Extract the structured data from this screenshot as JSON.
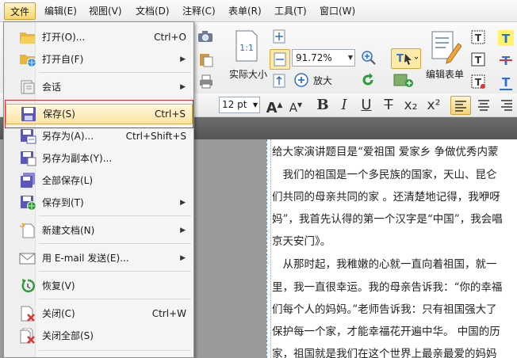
{
  "menubar": {
    "items": [
      "文件",
      "编辑(E)",
      "视图(V)",
      "文档(D)",
      "注释(C)",
      "表单(R)",
      "工具(T)",
      "窗口(W)"
    ]
  },
  "ribbon": {
    "zoom_value": "91.72%",
    "actual_size_label": "实际大小",
    "zoom_in_label": "放大",
    "zoom_out_label": "缩小",
    "edit_form_label": "编辑表单",
    "fit_icon_text": "1:1"
  },
  "format": {
    "font_size": "12 pt",
    "bold": "B",
    "italic": "I",
    "underline": "U",
    "strike": "T",
    "subscript": "x₂",
    "superscript": "x²"
  },
  "file_menu": {
    "items": [
      {
        "label": "打开(O)...",
        "shortcut": "Ctrl+O",
        "icon": "folder-open-icon"
      },
      {
        "label": "打开自(F)",
        "shortcut": "",
        "submenu": true,
        "icon": "folder-globe-icon"
      },
      {
        "label": "会话",
        "shortcut": "",
        "submenu": true,
        "icon": "session-icon"
      },
      {
        "label": "保存(S)",
        "shortcut": "Ctrl+S",
        "icon": "save-icon"
      },
      {
        "label": "另存为(A)...",
        "shortcut": "Ctrl+Shift+S",
        "icon": "save-as-icon"
      },
      {
        "label": "另存为副本(Y)...",
        "shortcut": "",
        "icon": "save-copy-icon"
      },
      {
        "label": "全部保存(L)",
        "shortcut": "",
        "icon": "save-all-icon"
      },
      {
        "label": "保存到(T)",
        "shortcut": "",
        "submenu": true,
        "icon": "save-to-icon"
      },
      {
        "label": "新建文档(N)",
        "shortcut": "",
        "submenu": true,
        "icon": "new-document-icon"
      },
      {
        "label": "用 E-mail 发送(E)...",
        "shortcut": "",
        "submenu": true,
        "icon": "email-icon"
      },
      {
        "label": "恢复(V)",
        "shortcut": "",
        "icon": "revert-icon"
      },
      {
        "label": "关闭(C)",
        "shortcut": "Ctrl+W",
        "icon": "close-doc-icon"
      },
      {
        "label": "关闭全部(S)",
        "shortcut": "",
        "icon": "close-all-icon"
      }
    ]
  },
  "document": {
    "lines": [
      "给大家演讲题目是“爱祖国 爱家乡 争做优秀内蒙",
      "　我们的祖国是一个多民族的国家，天山、昆仑",
      "们共同的母亲共同的家 。还清楚地记得，我咿呀",
      "妈”，我首先认得的第一个汉字是“中国”，我会唱",
      "京天安门》。",
      "　从那时起，我稚嫩的心就一直向着祖国，就一",
      "里，我一直很幸运。我的母亲告诉我：“你的幸福",
      "们每个人的妈妈。”老师告诉我：只有祖国强大了",
      "保护每一个家，才能幸福花开遍中华。  中国的历",
      "家，祖国就是我们在这个世界上最亲最爱的妈妈"
    ]
  },
  "colors": {
    "highlight": "#fbe3a1",
    "red_box": "#d03030",
    "accent_blue": "#2f6fce"
  }
}
